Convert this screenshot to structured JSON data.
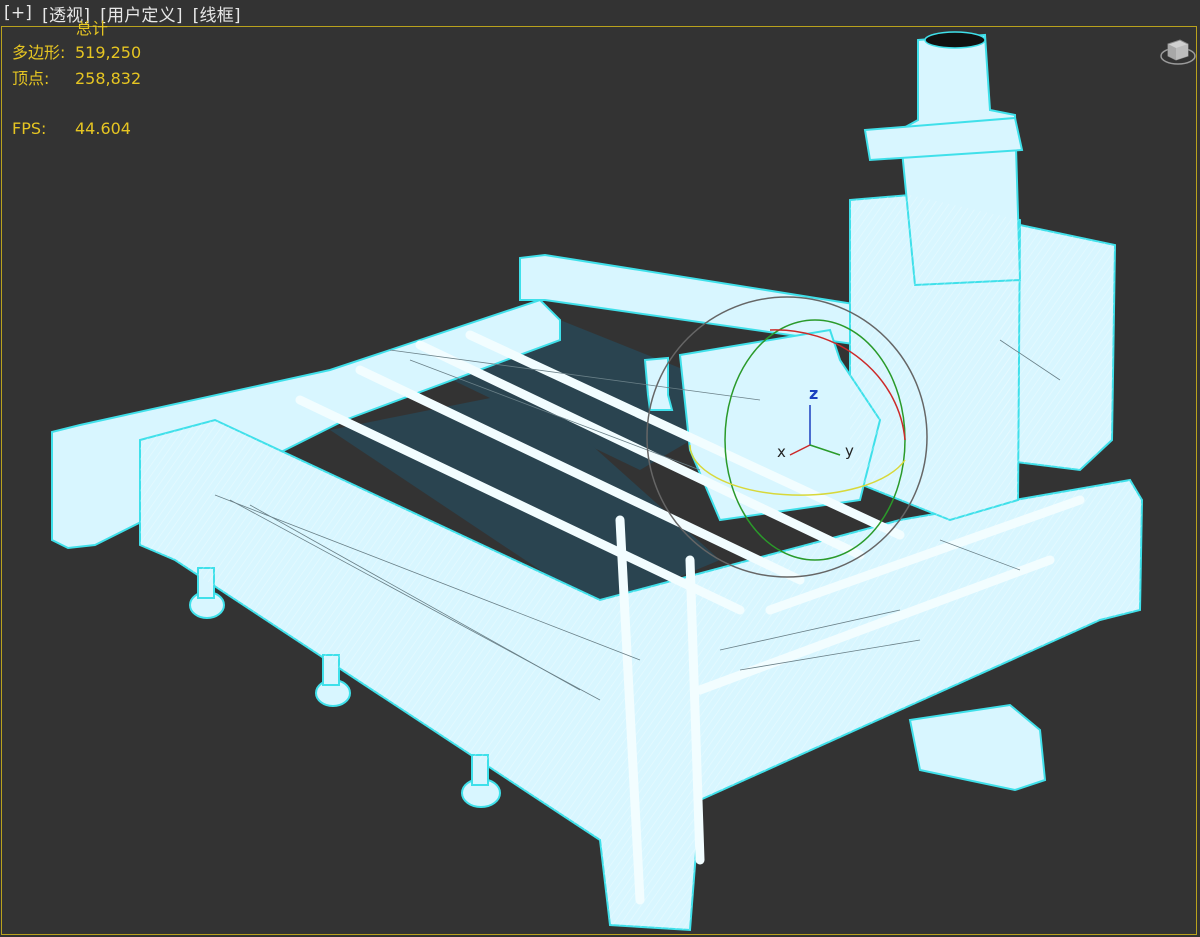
{
  "viewport_labels": [
    "[+]",
    "[透视]",
    "[用户定义]",
    "[线框]"
  ],
  "stats": {
    "total_label": "总计",
    "polygons_label": "多边形:",
    "polygons_value": "519,250",
    "vertices_label": "顶点:",
    "vertices_value": "258,832",
    "fps_label": "FPS:",
    "fps_value": "44.604"
  },
  "gizmo": {
    "axis_z": "z",
    "axis_x": "x",
    "axis_y": "y"
  },
  "colors": {
    "wire": "#d8f6ff",
    "edge": "#3fe0ea",
    "background": "#333333",
    "stats_text": "#e6c522",
    "active_border": "#b9a21d",
    "gizmo_x": "#cc2a2a",
    "gizmo_y": "#d8d83a",
    "gizmo_z": "#2a9a2a",
    "gizmo_label": "#1a3fbf"
  },
  "viewcube_icon": "viewcube-icon"
}
